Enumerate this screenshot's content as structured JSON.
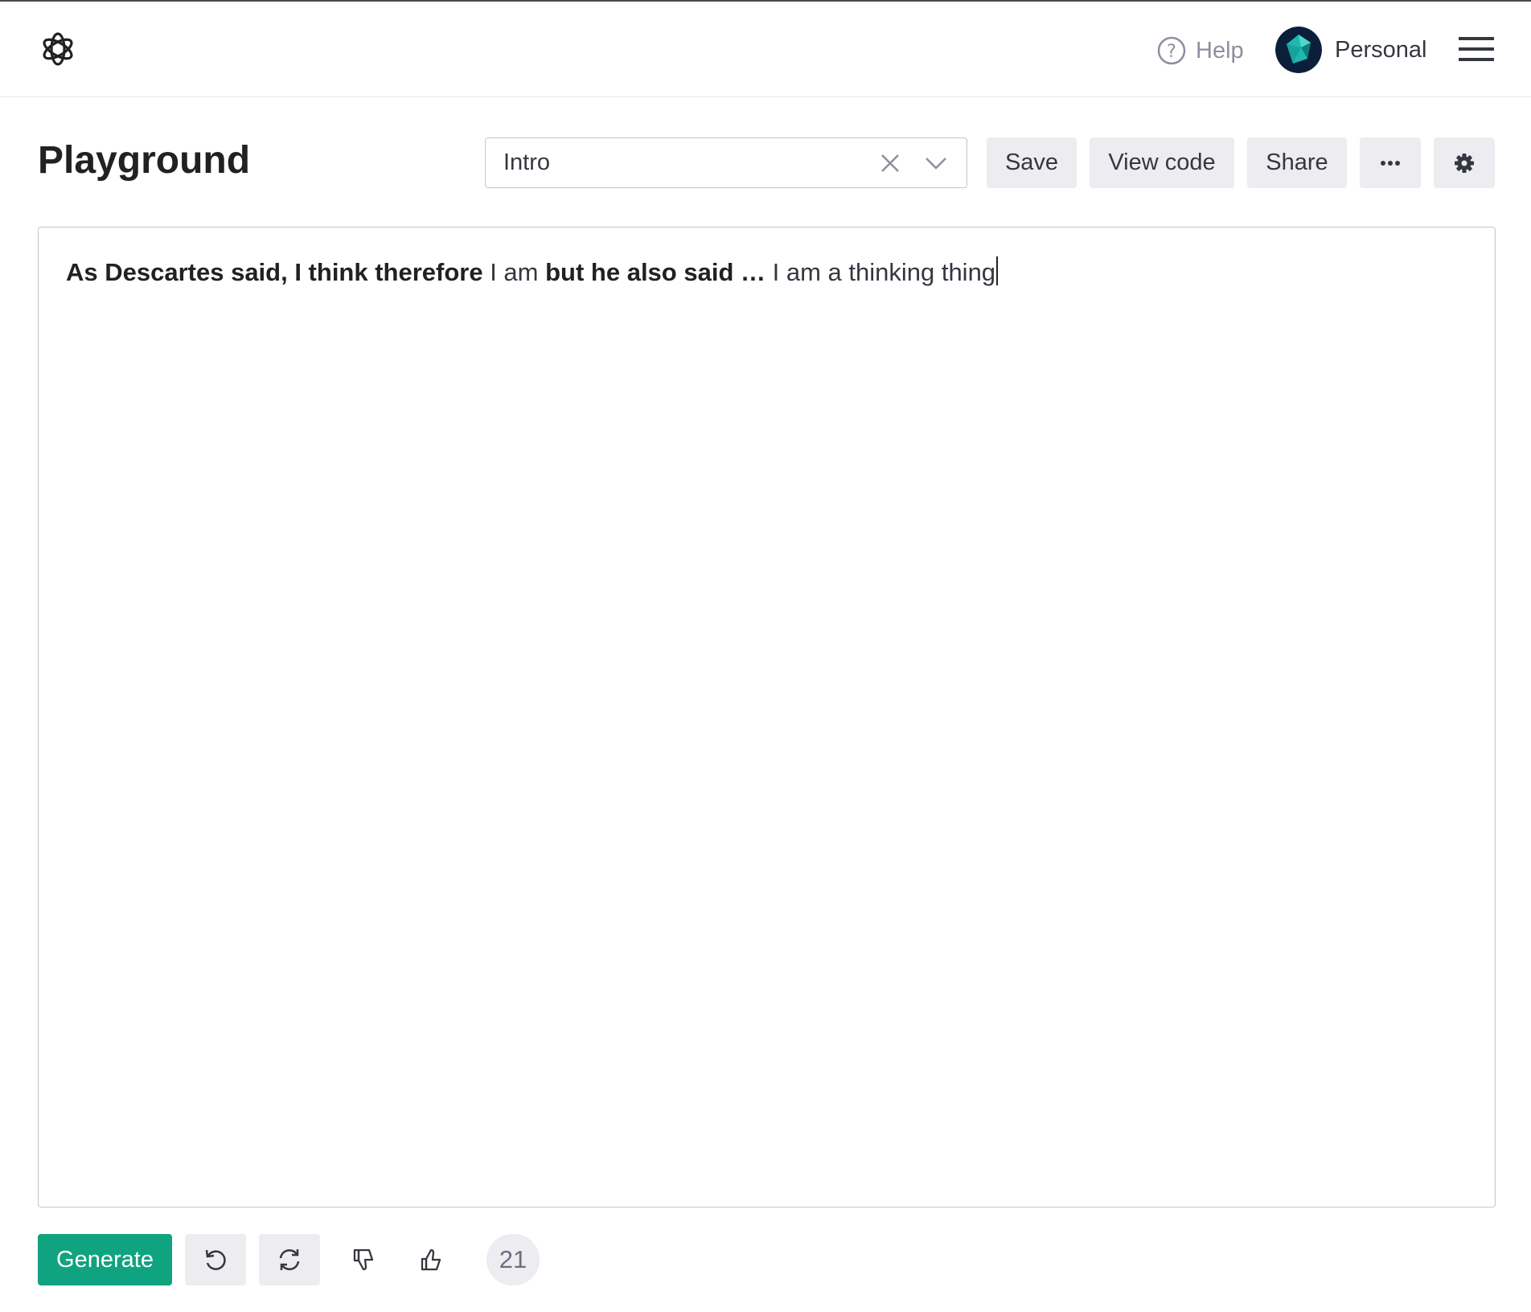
{
  "header": {
    "help_label": "Help",
    "account_label": "Personal"
  },
  "page": {
    "title": "Playground"
  },
  "preset": {
    "value": "Intro"
  },
  "toolbar": {
    "save_label": "Save",
    "view_code_label": "View code",
    "share_label": "Share",
    "more_label": "···"
  },
  "editor": {
    "segments": [
      {
        "text": "As Descartes said, I think therefore ",
        "bold": true
      },
      {
        "text": "I am ",
        "bold": false
      },
      {
        "text": "but he also said … ",
        "bold": true
      },
      {
        "text": "I am a thinking thing",
        "bold": false
      }
    ]
  },
  "footer": {
    "generate_label": "Generate",
    "token_count": "21"
  },
  "colors": {
    "accent": "#10a37f",
    "button_bg": "#ececf1",
    "border": "#c5c5d2"
  },
  "icons": [
    "openai-logo-icon",
    "help-icon",
    "avatar",
    "menu-icon",
    "close-icon",
    "chevron-down-icon",
    "more-icon",
    "gear-icon",
    "undo-icon",
    "regenerate-icon",
    "thumbs-down-icon",
    "thumbs-up-icon"
  ]
}
